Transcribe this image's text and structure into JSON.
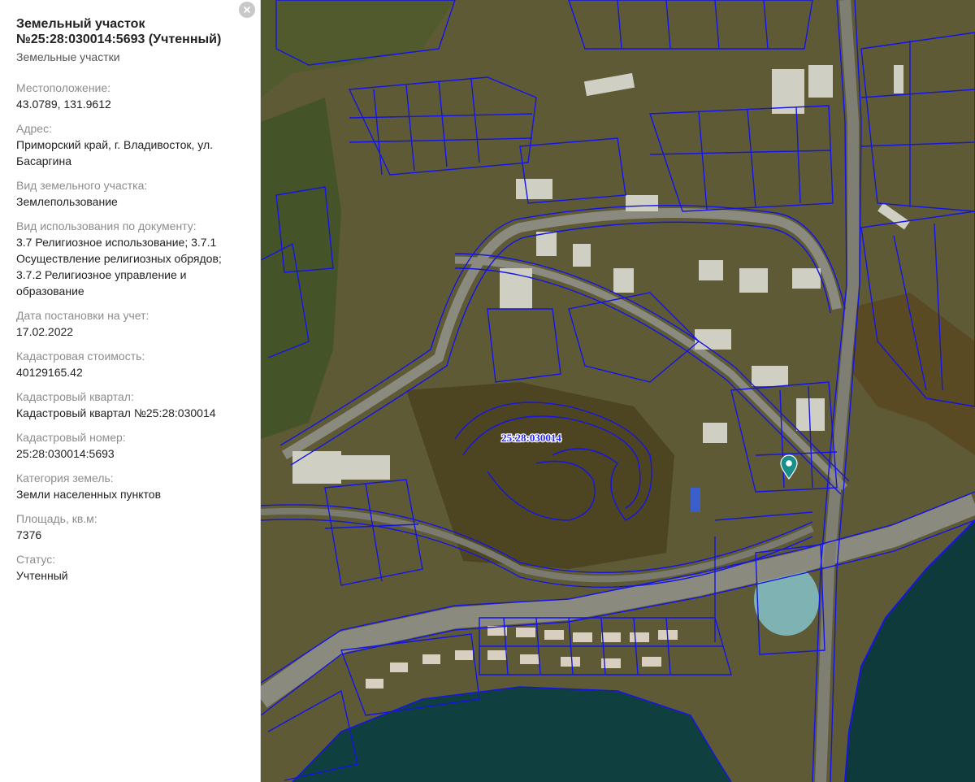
{
  "panel": {
    "title": "Земельный участок №25:28:030014:5693 (Учтенный)",
    "subtitle": "Земельные участки",
    "fields": [
      {
        "label": "Местоположение:",
        "value": "43.0789, 131.9612"
      },
      {
        "label": "Адрес:",
        "value": "Приморский край, г. Владивосток, ул.\nБасаргина"
      },
      {
        "label": "Вид земельного участка:",
        "value": "Землепользование"
      },
      {
        "label": "Вид использования по документу:",
        "value": "3.7 Религиозное использование; 3.7.1\nОсуществление религиозных обрядов;\n3.7.2 Религиозное управление и\nобразование"
      },
      {
        "label": "Дата постановки на учет:",
        "value": "17.02.2022"
      },
      {
        "label": "Кадастровая стоимость:",
        "value": "40129165.42"
      },
      {
        "label": "Кадастровый квартал:",
        "value": "Кадастровый квартал №25:28:030014"
      },
      {
        "label": "Кадастровый номер:",
        "value": "25:28:030014:5693"
      },
      {
        "label": "Категория земель:",
        "value": "Земли населенных пунктов"
      },
      {
        "label": "Площадь, кв.м:",
        "value": "7376"
      },
      {
        "label": "Статус:",
        "value": "Учтенный"
      }
    ],
    "close_icon": "close-icon"
  },
  "map": {
    "quarter_label": "25:28:030014",
    "marker_icon": "map-pin-icon",
    "colors": {
      "boundary": "#1414e6",
      "land": "#5e5a36",
      "forest": "#4d4422",
      "road": "#8a8a7e",
      "sea": "#0e3a3c",
      "marker": "#1a8f8a"
    }
  }
}
